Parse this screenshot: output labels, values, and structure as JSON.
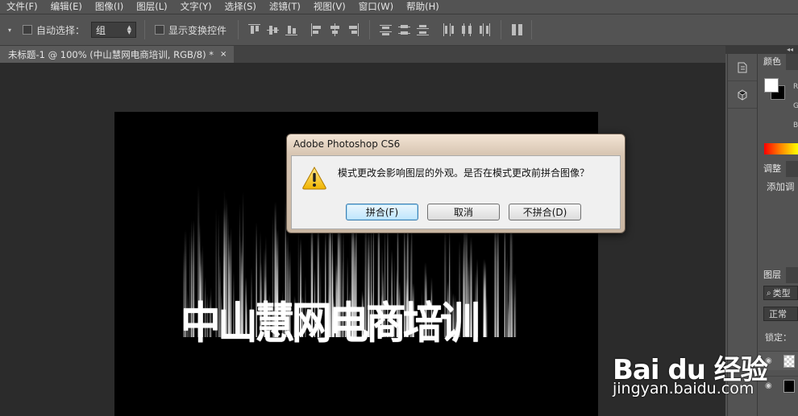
{
  "menu": [
    "文件(F)",
    "编辑(E)",
    "图像(I)",
    "图层(L)",
    "文字(Y)",
    "选择(S)",
    "滤镜(T)",
    "视图(V)",
    "窗口(W)",
    "帮助(H)"
  ],
  "options": {
    "auto_select_label": "自动选择：",
    "auto_select_value": "组",
    "show_transform_label": "显示变换控件"
  },
  "document_tab": {
    "title": "未标题-1 @ 100% (中山慧网电商培训, RGB/8) *",
    "close": "×"
  },
  "canvas": {
    "text": "中山慧网电商培训"
  },
  "panels": {
    "collapse": "◂◂",
    "color_tab": "颜色",
    "color_letters": [
      "R",
      "G",
      "B"
    ],
    "adjust_tab": "调整",
    "adjust_text": "添加调",
    "layers_tab": "图层",
    "filter_kind": "类型",
    "blend_mode": "正常",
    "lock_label": "锁定："
  },
  "dialog": {
    "title": "Adobe Photoshop CS6",
    "message": "模式更改会影响图层的外观。是否在模式更改前拼合图像？",
    "buttons": {
      "flatten": "拼合(F)",
      "cancel": "取消",
      "dont_flatten": "不拼合(D)"
    }
  },
  "watermark": {
    "brand": "Bai du 经验",
    "url": "jingyan.baidu.com"
  },
  "colors": {
    "ui_bg": "#535353",
    "workspace": "#2b2b2b",
    "default_button_border": "#3c7fb1"
  }
}
